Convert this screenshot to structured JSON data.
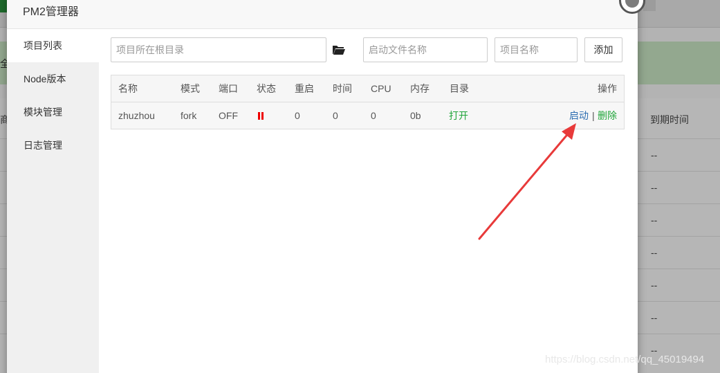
{
  "modal": {
    "title": "PM2管理器"
  },
  "sidebar": {
    "items": [
      {
        "label": "项目列表",
        "active": true
      },
      {
        "label": "Node版本",
        "active": false
      },
      {
        "label": "模块管理",
        "active": false
      },
      {
        "label": "日志管理",
        "active": false
      }
    ]
  },
  "toolbar": {
    "root_dir_placeholder": "项目所在根目录",
    "folder_icon": "folder-open-icon",
    "start_file_placeholder": "启动文件名称",
    "project_name_placeholder": "项目名称",
    "add_label": "添加"
  },
  "table": {
    "headers": {
      "name": "名称",
      "mode": "模式",
      "port": "端口",
      "status": "状态",
      "restart": "重启",
      "time": "时间",
      "cpu": "CPU",
      "memory": "内存",
      "dir": "目录",
      "actions": "操作"
    },
    "rows": [
      {
        "name": "zhuzhou",
        "mode": "fork",
        "port": "OFF",
        "status_icon": "pause-icon",
        "restart": "0",
        "time": "0",
        "cpu": "0",
        "memory": "0b",
        "dir_link": "打开",
        "action_start": "启动",
        "action_sep": "|",
        "action_delete": "删除"
      }
    ]
  },
  "background": {
    "header_right": "到期时间",
    "notice_char": "全",
    "header_left_char": "商",
    "dash": "--"
  },
  "watermark": "https://blog.csdn.net/qq_45019494",
  "colors": {
    "green_link": "#20a53a",
    "blue_link": "#2b6cb0",
    "status_red": "#ee0000",
    "arrow_red": "#e83a3a"
  }
}
